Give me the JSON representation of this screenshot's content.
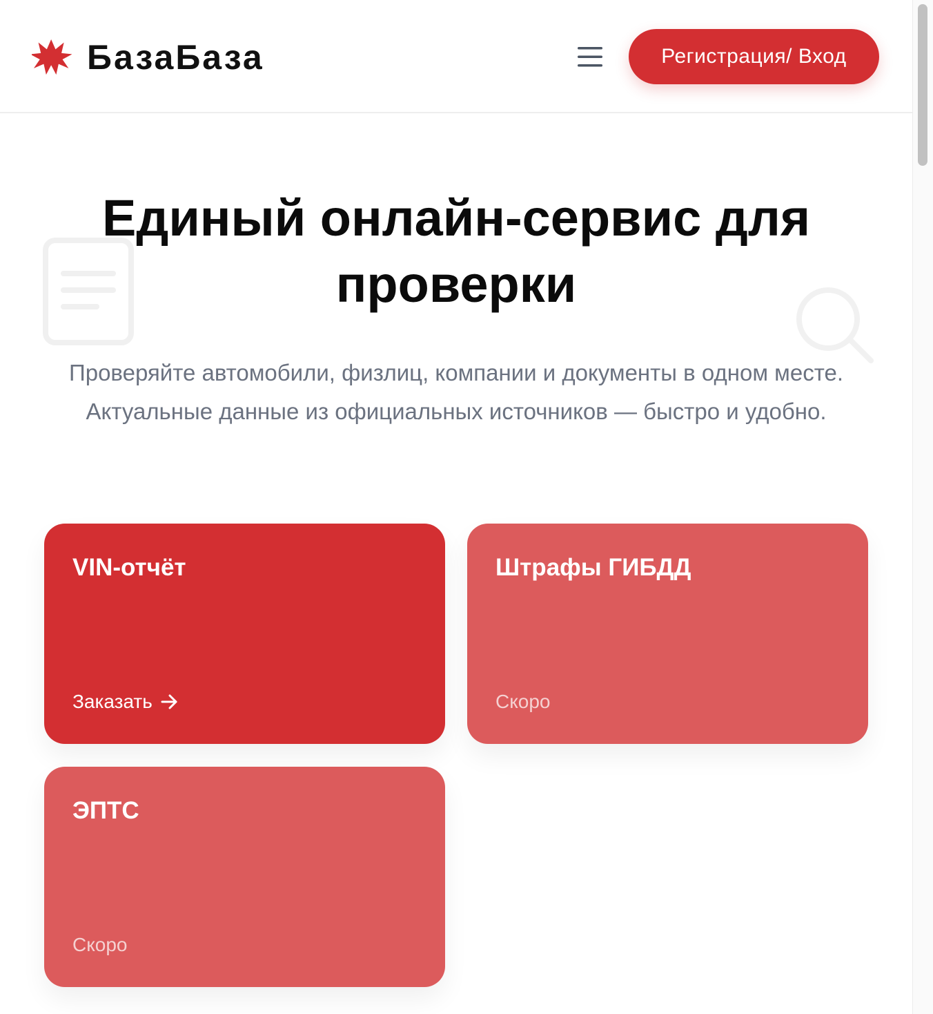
{
  "header": {
    "logo_text": "БазаБаза",
    "menu_icon": "hamburger-menu-icon",
    "auth_button_label": "Регистрация/ Вход"
  },
  "hero": {
    "title": "Единый онлайн-сервис для проверки",
    "subtitle": "Проверяйте автомобили, физлиц, компании и документы в одном месте. Актуальные данные из официальных источников — быстро и удобно.",
    "decor_icons": [
      "document-icon",
      "search-icon"
    ]
  },
  "services": [
    {
      "title": "VIN-отчёт",
      "action": "Заказать",
      "status": "active",
      "icon": "arrow-right-icon"
    },
    {
      "title": "Штрафы ГИБДД",
      "action": "Скоро",
      "status": "soon"
    },
    {
      "title": "ЭПТС",
      "action": "Скоро",
      "status": "soon"
    }
  ],
  "colors": {
    "brand_red": "#d32f32",
    "card_soon": "#dc5b5c",
    "subtitle_gray": "#6b7280"
  }
}
